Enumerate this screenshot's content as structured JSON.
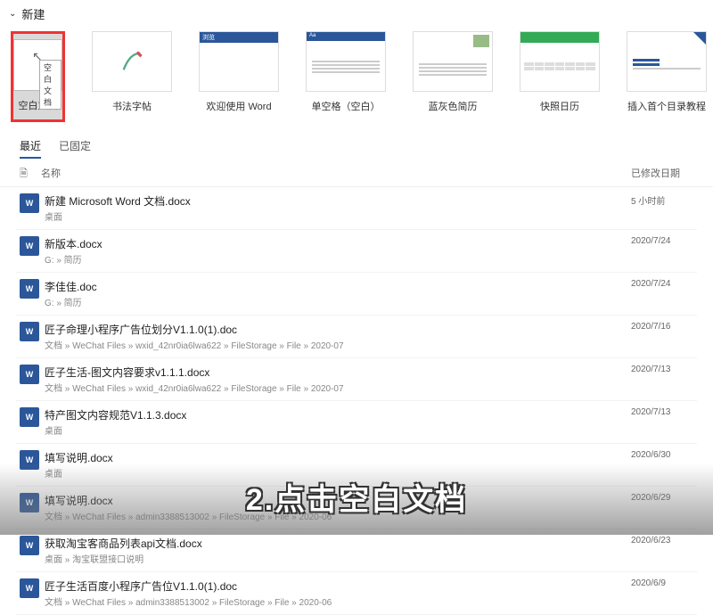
{
  "header": {
    "title": "新建"
  },
  "templates": [
    {
      "label": "空白文档",
      "tooltip": "空白文档",
      "highlighted": true
    },
    {
      "label": "书法字帖"
    },
    {
      "label": "欢迎使用 Word"
    },
    {
      "label": "单空格（空白）"
    },
    {
      "label": "蓝灰色简历"
    },
    {
      "label": "快照日历"
    },
    {
      "label": "插入首个目录教程"
    }
  ],
  "tabs": {
    "recent": "最近",
    "pinned": "已固定"
  },
  "list_header": {
    "name": "名称",
    "date": "已修改日期"
  },
  "files": [
    {
      "name": "新建 Microsoft Word 文档.docx",
      "path": "桌面",
      "date": "5 小时前"
    },
    {
      "name": "新版本.docx",
      "path": "G: » 简历",
      "date": "2020/7/24"
    },
    {
      "name": "李佳佳.doc",
      "path": "G: » 简历",
      "date": "2020/7/24"
    },
    {
      "name": "匠子命理小程序广告位划分V1.1.0(1).doc",
      "path": "文档 » WeChat Files » wxid_42nr0ia6lwa622 » FileStorage » File » 2020-07",
      "date": "2020/7/16"
    },
    {
      "name": "匠子生活-图文内容要求v1.1.1.docx",
      "path": "文档 » WeChat Files » wxid_42nr0ia6lwa622 » FileStorage » File » 2020-07",
      "date": "2020/7/13"
    },
    {
      "name": "特产图文内容规范V1.1.3.docx",
      "path": "桌面",
      "date": "2020/7/13"
    },
    {
      "name": "填写说明.docx",
      "path": "桌面",
      "date": "2020/6/30"
    },
    {
      "name": "填写说明.docx",
      "path": "文档 » WeChat Files » admin3388513002 » FileStorage » File » 2020-06",
      "date": "2020/6/29"
    },
    {
      "name": "获取淘宝客商品列表api文档.docx",
      "path": "桌面 » 淘宝联盟接口说明",
      "date": "2020/6/23"
    },
    {
      "name": "匠子生活百度小程序广告位V1.1.0(1).doc",
      "path": "文档 » WeChat Files » admin3388513002 » FileStorage » File » 2020-06",
      "date": "2020/6/9"
    }
  ],
  "caption": "2.点击空白文档",
  "icon_text": "W"
}
